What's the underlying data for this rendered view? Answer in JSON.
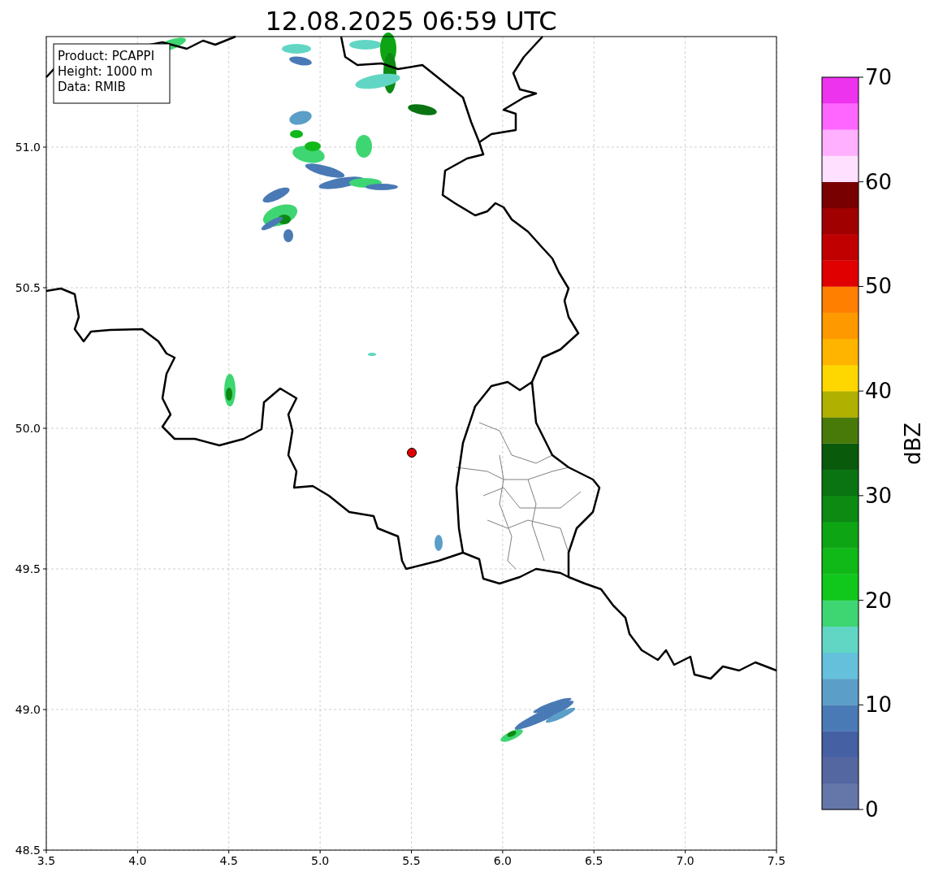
{
  "title": "12.08.2025 06:59 UTC",
  "info_box": [
    "Product: PCAPPI",
    "Height: 1000 m",
    "Data: RMIB"
  ],
  "x_ticks": [
    "3.5",
    "4.0",
    "4.5",
    "5.0",
    "5.5",
    "6.0",
    "6.5",
    "7.0",
    "7.5"
  ],
  "y_ticks": [
    "51.0",
    "50.5",
    "50.0",
    "49.5",
    "49.0",
    "48.5"
  ],
  "colorbar": {
    "label": "dBZ",
    "ticks": [
      "70",
      "60",
      "50",
      "40",
      "30",
      "20",
      "10",
      "0"
    ],
    "segments": [
      {
        "color": "#6577a8"
      },
      {
        "color": "#5567a0"
      },
      {
        "color": "#4560a3"
      },
      {
        "color": "#4a7ab5"
      },
      {
        "color": "#5b9ec8"
      },
      {
        "color": "#65c0dc"
      },
      {
        "color": "#62d6c4"
      },
      {
        "color": "#3ed672"
      },
      {
        "color": "#10c81c"
      },
      {
        "color": "#10b818"
      },
      {
        "color": "#0ea514"
      },
      {
        "color": "#0c8a12"
      },
      {
        "color": "#0a7412"
      },
      {
        "color": "#0a5a0c"
      },
      {
        "color": "#487a0a"
      },
      {
        "color": "#b0b000"
      },
      {
        "color": "#ffd700"
      },
      {
        "color": "#ffb400"
      },
      {
        "color": "#ff9900"
      },
      {
        "color": "#ff7f00"
      },
      {
        "color": "#e00000"
      },
      {
        "color": "#c00000"
      },
      {
        "color": "#a00000"
      },
      {
        "color": "#780000"
      },
      {
        "color": "#ffe0ff"
      },
      {
        "color": "#ffb0ff"
      },
      {
        "color": "#ff66ff"
      },
      {
        "color": "#ee33ee"
      }
    ]
  }
}
